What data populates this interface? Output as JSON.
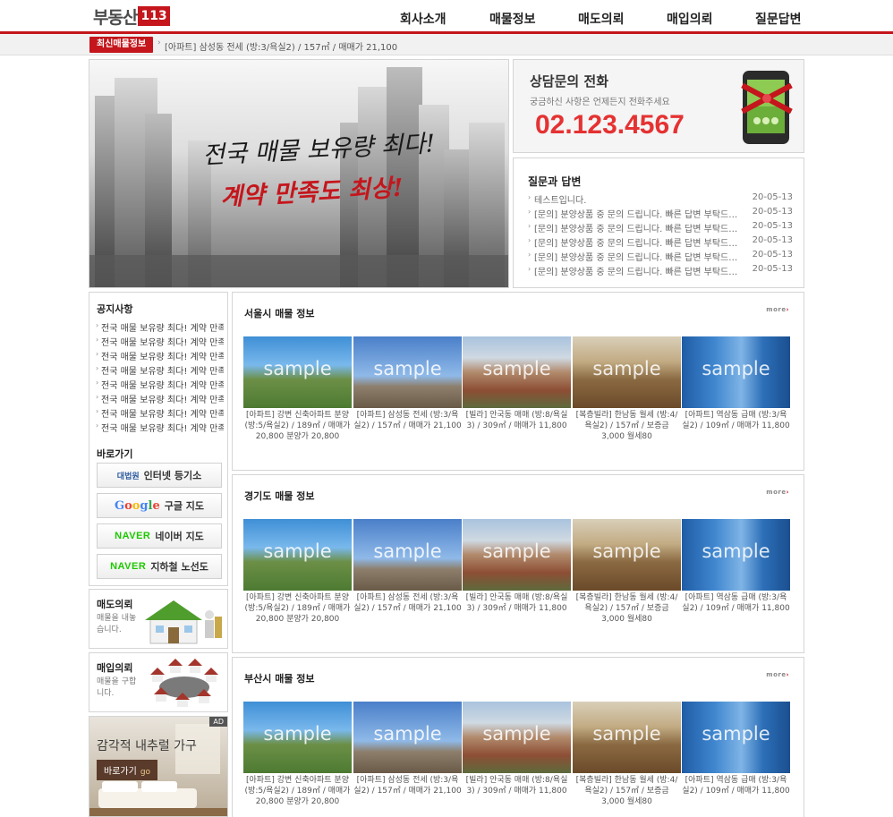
{
  "header": {
    "logo_text": "부동산",
    "logo_num": "113",
    "nav": [
      "회사소개",
      "매물정보",
      "매도의뢰",
      "매입의뢰",
      "질문답변"
    ]
  },
  "ticker": {
    "badge": "최신매물정보",
    "arrow": "›",
    "text": "[아파트] 삼성동 전세 (방:3/욕실2) / 157㎡ / 매매가 21,100"
  },
  "hero": {
    "line1": "전국 매물 보유량 최다!",
    "line2": "계약 만족도 최상!"
  },
  "contact": {
    "title": "상담문의 전화",
    "subtitle": "궁금하신 사항은 언제든지 전화주세요",
    "phone": "02.123.4567"
  },
  "qna": {
    "title": "질문과 답변",
    "items": [
      {
        "text": "테스트입니다.",
        "date": "20-05-13"
      },
      {
        "text": "[문의] 분양상품 중 문의 드립니다. 빠른 답변 부탁드립니다.",
        "date": "20-05-13"
      },
      {
        "text": "[문의] 분양상품 중 문의 드립니다. 빠른 답변 부탁드립니다.",
        "date": "20-05-13"
      },
      {
        "text": "[문의] 분양상품 중 문의 드립니다. 빠른 답변 부탁드립니다.",
        "date": "20-05-13"
      },
      {
        "text": "[문의] 분양상품 중 문의 드립니다. 빠른 답변 부탁드립니다.",
        "date": "20-05-13"
      },
      {
        "text": "[문의] 분양상품 중 문의 드립니다. 빠른 답변 부탁드립니다.",
        "date": "20-05-13"
      }
    ]
  },
  "notice": {
    "title": "공지사항",
    "items": [
      "전국 매물 보유량 최다! 계약 만족도 최상!",
      "전국 매물 보유량 최다! 계약 만족도 최상!",
      "전국 매물 보유량 최다! 계약 만족도 최상!",
      "전국 매물 보유량 최다! 계약 만족도 최상!",
      "전국 매물 보유량 최다! 계약 만족도 최상!",
      "전국 매물 보유량 최다! 계약 만족도 최상!",
      "전국 매물 보유량 최다! 계약 만족도 최상!",
      "전국 매물 보유량 최다! 계약 만족도 최상!"
    ]
  },
  "shortcuts": {
    "title": "바로가기",
    "items": [
      {
        "brand": "대법원",
        "label": "인터넷 등기소"
      },
      {
        "brand": "Google",
        "label": "구글 지도"
      },
      {
        "brand": "NAVER",
        "label": "네이버 지도"
      },
      {
        "brand": "NAVER",
        "label": "지하철 노선도"
      }
    ]
  },
  "sell_request": {
    "title": "매도의뢰",
    "desc": "매물을 내놓습니다."
  },
  "buy_request": {
    "title": "매입의뢰",
    "desc": "매물을 구합니다."
  },
  "ad": {
    "tag": "AD",
    "title": "감각적 내추럴 가구",
    "button": "바로가기",
    "go": "go"
  },
  "sections": [
    {
      "title": "서울시 매물 정보",
      "more": "more",
      "cards": [
        {
          "img": "house",
          "watermark": "sample",
          "caption": "[아파트] 강변 신축아파트 분양 (방:5/욕실2) / 189㎡ / 매매가 20,800 분양가 20,800"
        },
        {
          "img": "crane",
          "watermark": "sample",
          "caption": "[아파트] 삼성동 전세 (방:3/욕실2) / 157㎡ / 매매가 21,100"
        },
        {
          "img": "villa",
          "watermark": "sample",
          "caption": "[빌라] 안국동 매매 (방:8/욕실3) / 309㎡ / 매매가 11,800"
        },
        {
          "img": "room",
          "watermark": "sample",
          "caption": "[복층빌라] 한남동 월세 (방:4/욕실2) / 157㎡ / 보증금 3,000 월세80"
        },
        {
          "img": "tower",
          "watermark": "sample",
          "caption": "[아파트] 역삼동 급매 (방:3/욕실2) / 109㎡ / 매매가 11,800"
        }
      ]
    },
    {
      "title": "경기도 매물 정보",
      "more": "more",
      "cards": [
        {
          "img": "house",
          "watermark": "sample",
          "caption": "[아파트] 강변 신축아파트 분양 (방:5/욕실2) / 189㎡ / 매매가 20,800 분양가 20,800"
        },
        {
          "img": "crane",
          "watermark": "sample",
          "caption": "[아파트] 삼성동 전세 (방:3/욕실2) / 157㎡ / 매매가 21,100"
        },
        {
          "img": "villa",
          "watermark": "sample",
          "caption": "[빌라] 안국동 매매 (방:8/욕실3) / 309㎡ / 매매가 11,800"
        },
        {
          "img": "room",
          "watermark": "sample",
          "caption": "[복층빌라] 한남동 월세 (방:4/욕실2) / 157㎡ / 보증금 3,000 월세80"
        },
        {
          "img": "tower",
          "watermark": "sample",
          "caption": "[아파트] 역삼동 급매 (방:3/욕실2) / 109㎡ / 매매가 11,800"
        }
      ]
    },
    {
      "title": "부산시 매물 정보",
      "more": "more",
      "cards": [
        {
          "img": "house",
          "watermark": "sample",
          "caption": "[아파트] 강변 신축아파트 분양 (방:5/욕실2) / 189㎡ / 매매가 20,800 분양가 20,800"
        },
        {
          "img": "crane",
          "watermark": "sample",
          "caption": "[아파트] 삼성동 전세 (방:3/욕실2) / 157㎡ / 매매가 21,100"
        },
        {
          "img": "villa",
          "watermark": "sample",
          "caption": "[빌라] 안국동 매매 (방:8/욕실3) / 309㎡ / 매매가 11,800"
        },
        {
          "img": "room",
          "watermark": "sample",
          "caption": "[복층빌라] 한남동 월세 (방:4/욕실2) / 157㎡ / 보증금 3,000 월세80"
        },
        {
          "img": "tower",
          "watermark": "sample",
          "caption": "[아파트] 역삼동 급매 (방:3/욕실2) / 109㎡ / 매매가 11,800"
        }
      ]
    }
  ],
  "colors": {
    "brand": "#c4161c",
    "phone": "#e53232",
    "naver": "#1ec800"
  }
}
